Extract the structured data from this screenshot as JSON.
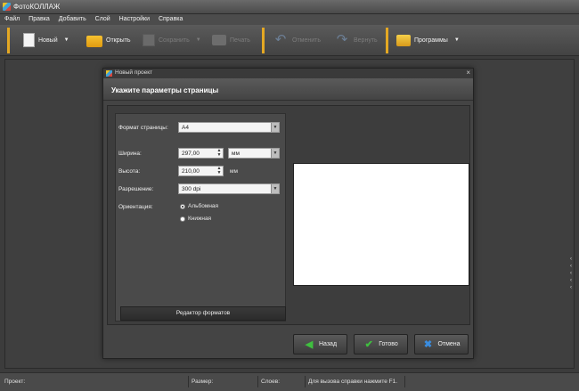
{
  "window": {
    "title": "ФотоКОЛЛАЖ"
  },
  "menu": [
    "Файл",
    "Правка",
    "Добавить",
    "Слой",
    "Настройки",
    "Справка"
  ],
  "toolbar": {
    "new_label": "Новый",
    "open_label": "Открыть",
    "save_label": "Сохранить",
    "print_label": "Печать",
    "undo_label": "Отменить",
    "redo_label": "Вернуть",
    "programs_label": "Программы"
  },
  "dialog": {
    "title": "Новый проект",
    "close_symbol": "×",
    "header": "Укажите параметры страницы",
    "format_label": "Формат страницы:",
    "format_value": "А4",
    "width_label": "Ширина:",
    "width_value": "297,00",
    "width_unit": "мм",
    "height_label": "Высота:",
    "height_value": "210,00",
    "height_unit": "мм",
    "resolution_label": "Разрешение:",
    "resolution_value": "300 dpi",
    "orientation_label": "Ориентация:",
    "orientation_options": [
      "Альбомная",
      "Книжная"
    ],
    "orientation_selected": "Альбомная",
    "editor_button": "Редактор форматов",
    "back_button": "Назад",
    "done_button": "Готово",
    "cancel_button": "Отмена"
  },
  "statusbar": {
    "project_label": "Проект:",
    "size_label": "Размер:",
    "layers_label": "Слоев:",
    "help_text": "Для вызова справки нажмите F1."
  }
}
